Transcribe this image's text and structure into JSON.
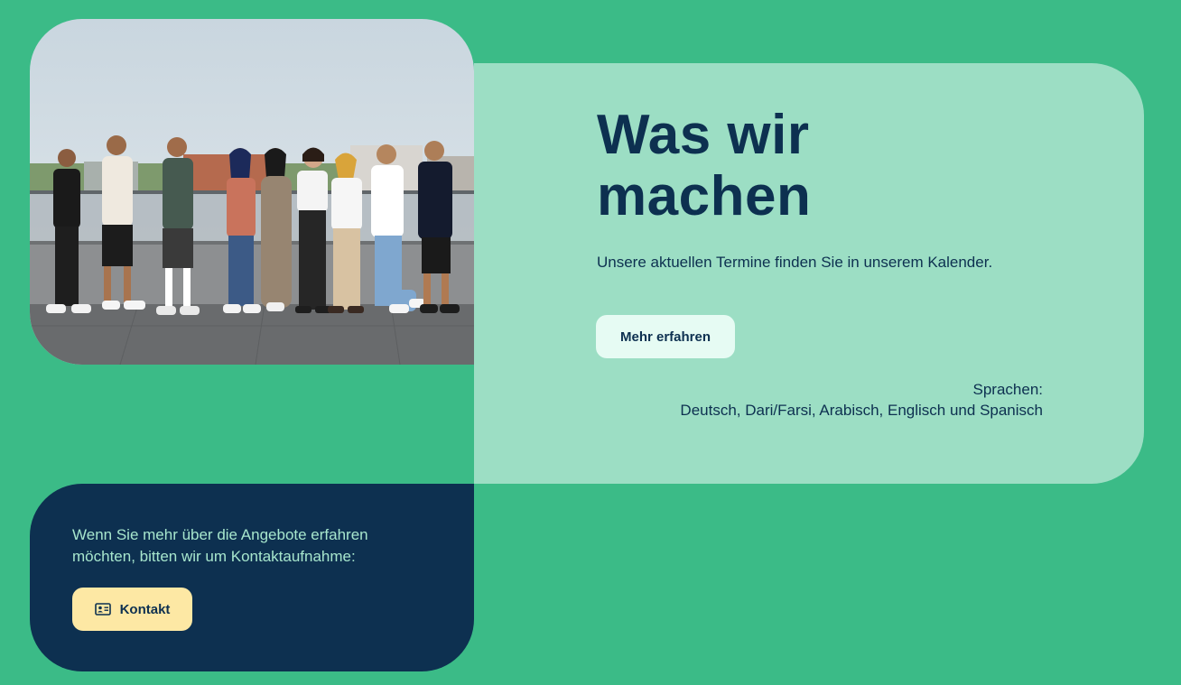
{
  "colors": {
    "background": "#3bbb87",
    "info_card": "#9cdec4",
    "dark_card": "#0d3050",
    "more_button": "#e6fbf3",
    "contact_button": "#fde8a4",
    "light_text": "#a7e6cd"
  },
  "photo": {
    "icon": "group-photo"
  },
  "info": {
    "heading_line1": "Was wir",
    "heading_line2": "machen",
    "subtext": "Unsere aktuellen Termine finden Sie in unserem Kalender.",
    "more_button_label": "Mehr erfahren",
    "languages_label": "Sprachen:",
    "languages_list": "Deutsch, Dari/Farsi, Arabisch, Englisch und Spanisch"
  },
  "contact": {
    "text_line1": "Wenn Sie mehr über die Angebote erfahren",
    "text_line2": "möchten, bitten wir um Kontaktaufnahme:",
    "button_label": "Kontakt",
    "button_icon": "contact-card-icon"
  }
}
